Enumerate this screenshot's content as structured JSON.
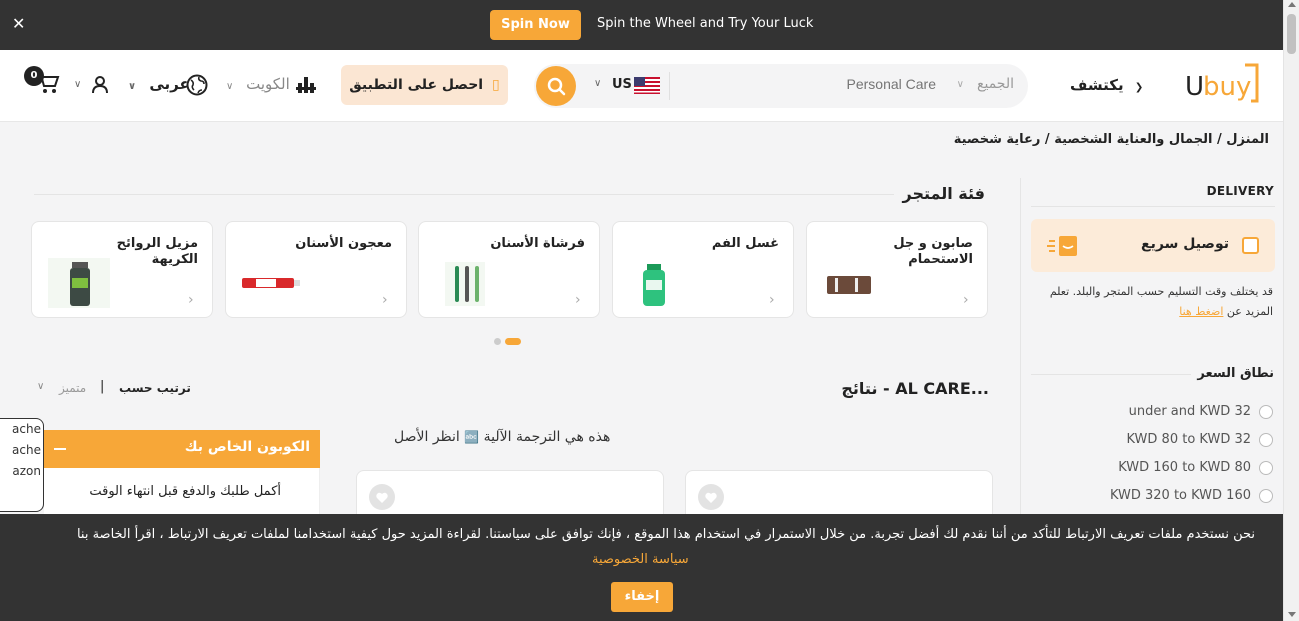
{
  "promo": {
    "close_label": "✕",
    "spin_button": "Spin Now",
    "text": "Spin the Wheel and Try Your Luck"
  },
  "header": {
    "logo_text": "Ubuy",
    "explore": "يكتشف",
    "search": {
      "category": "الجميع",
      "placeholder": "Personal Care",
      "store_code": "US"
    },
    "app_button": "احصل على التطبيق",
    "country": "الكويت",
    "language": "عربى",
    "cart_count": "0"
  },
  "breadcrumb": "المنزل / الجمال والعناية الشخصية / رعاية شخصية",
  "filters": {
    "delivery_title": "DELIVERY",
    "fast_delivery": "توصيل سريع",
    "delivery_note": "قد يختلف وقت التسليم حسب المتجر والبلد. تعلم المزيد عن",
    "delivery_link": "اضغط هنا",
    "price_title": "نطاق السعر",
    "price_options": [
      "under  and KWD 32",
      "KWD 80 to KWD 32",
      "KWD 160 to KWD 80",
      "KWD 320 to KWD 160"
    ]
  },
  "store_category": {
    "title": "فئة المتجر",
    "cards": [
      {
        "name": "صابون و جل الاستحمام"
      },
      {
        "name": "غسل الفم"
      },
      {
        "name": "فرشاة الأسنان"
      },
      {
        "name": "معجون الأسنان"
      },
      {
        "name": "مزيل الروائح الكريهة"
      }
    ]
  },
  "results": {
    "title": "نتائج - AL CARE...",
    "sort_label": "ترتيب حسب",
    "sort_sep": "|",
    "sort_value": "متميز",
    "translate_note": "هذه هي الترجمة الآلية",
    "view_original": "انظر الأصل"
  },
  "coupon": {
    "edge_lines": [
      "ache",
      "ache",
      "azon"
    ],
    "title": "الكوبون الخاص بك",
    "body": "أكمل طلبك والدفع قبل انتهاء الوقت"
  },
  "cookie": {
    "message": "نحن نستخدم ملفات تعريف الارتباط للتأكد من أننا نقدم لك أفضل تجربة. من خلال الاستمرار في استخدام هذا الموقع ، فإنك توافق على سياستنا. لقراءة المزيد حول كيفية استخدامنا لملفات تعريف الارتباط ، اقرأ الخاصة بنا",
    "privacy_link": "سياسة الخصوصية",
    "hide_button": "إخفاء"
  },
  "colors": {
    "accent": "#f7a738",
    "dark_bar": "#333333",
    "soft_accent": "#fbe6d3"
  }
}
